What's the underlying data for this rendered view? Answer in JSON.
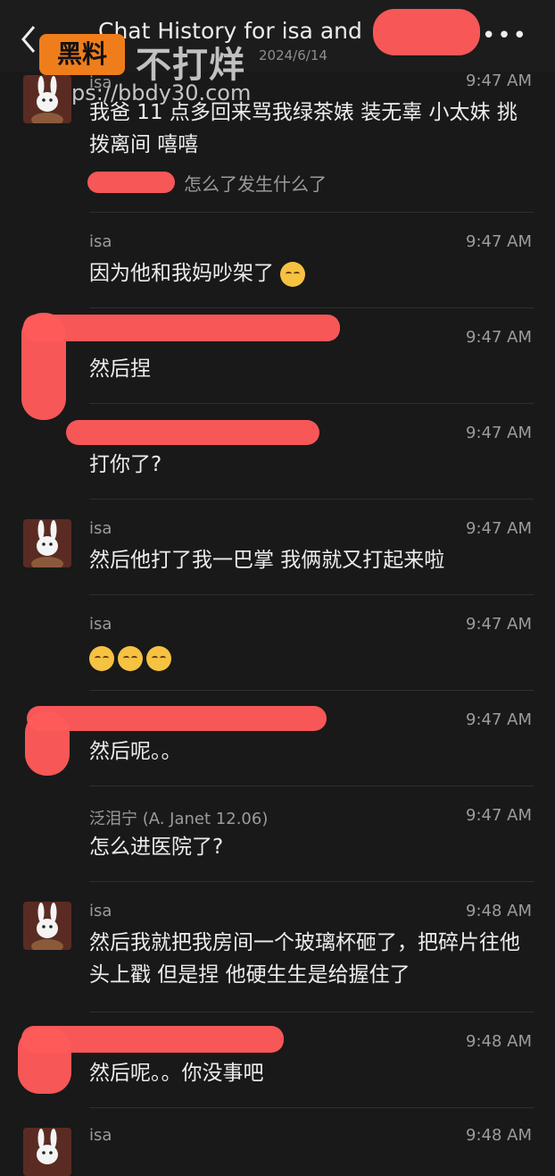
{
  "header": {
    "title": "Chat History for isa and",
    "date": "2024/6/14",
    "more_label": "•••"
  },
  "watermark": {
    "badge": "黑料",
    "text": "不打烊",
    "url": "https://bbdy30.com"
  },
  "messages": [
    {
      "name": "isa",
      "time": "9:47 AM",
      "text": "我爸 11 点多回来骂我绿茶婊 装无辜 小太妹 挑拨离间 嘻嘻",
      "quote": "怎么了发生什么了"
    },
    {
      "name": "isa",
      "time": "9:47 AM",
      "text": "因为他和我妈吵架了"
    },
    {
      "name": "",
      "time": "9:47 AM",
      "text": "然后捏"
    },
    {
      "name": "",
      "time": "9:47 AM",
      "text": "打你了?"
    },
    {
      "name": "isa",
      "time": "9:47 AM",
      "text": "然后他打了我一巴掌 我俩就又打起来啦"
    },
    {
      "name": "isa",
      "time": "9:47 AM",
      "text": ""
    },
    {
      "name": "",
      "time": "9:47 AM",
      "text": "然后呢。。"
    },
    {
      "name": "泛泪宁 (A. Janet 12.06)",
      "time": "9:47 AM",
      "text": "怎么进医院了?"
    },
    {
      "name": "isa",
      "time": "9:48 AM",
      "text": "然后我就把我房间一个玻璃杯砸了，把碎片往他头上戳 但是捏 他硬生生是给握住了"
    },
    {
      "name": "",
      "time": "9:48 AM",
      "text": "然后呢。。你没事吧"
    },
    {
      "name": "isa",
      "time": "9:48 AM",
      "text": ""
    }
  ],
  "colors": {
    "background": "#191919",
    "text": "#ececec",
    "meta": "#9b9b9b",
    "redaction": "#ff5a5a",
    "badge": "#f07d1b"
  }
}
